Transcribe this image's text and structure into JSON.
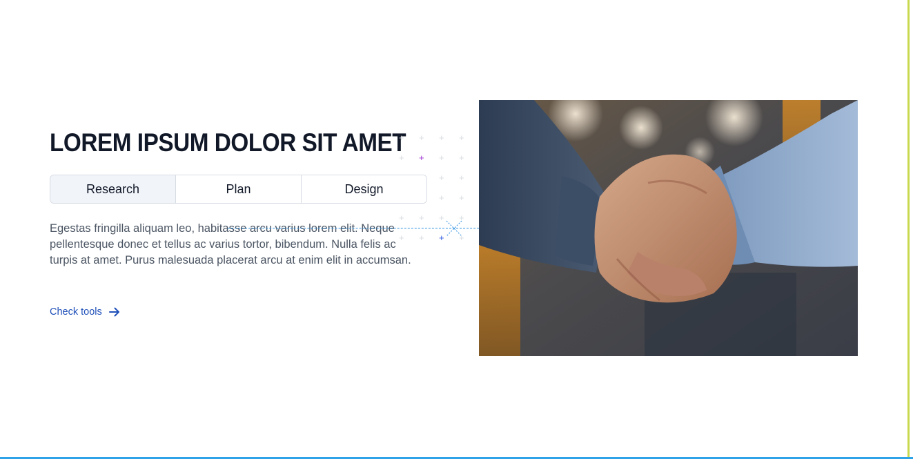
{
  "section": {
    "title": "LOREM IPSUM DOLOR SIT AMET",
    "tabs": [
      {
        "label": "Research",
        "active": true
      },
      {
        "label": "Plan",
        "active": false
      },
      {
        "label": "Design",
        "active": false
      }
    ],
    "description": "Egestas fringilla aliquam leo, habitasse arcu varius lorem elit. Neque pellentesque donec et tellus ac varius tortor, bibendum. Nulla felis ac turpis at amet. Purus malesuada placerat arcu at enim elit in accumsan.",
    "link_label": "Check tools",
    "link_icon": "arrow-right-icon"
  },
  "image": {
    "subject": "handshake-photo"
  },
  "colors": {
    "title": "#111827",
    "link": "#1e4fb8",
    "active_tab_bg": "#f1f4f9",
    "accent_purple": "#9b2fd1",
    "accent_blue": "#2a58e0",
    "guide_line": "#2a8fe0"
  }
}
